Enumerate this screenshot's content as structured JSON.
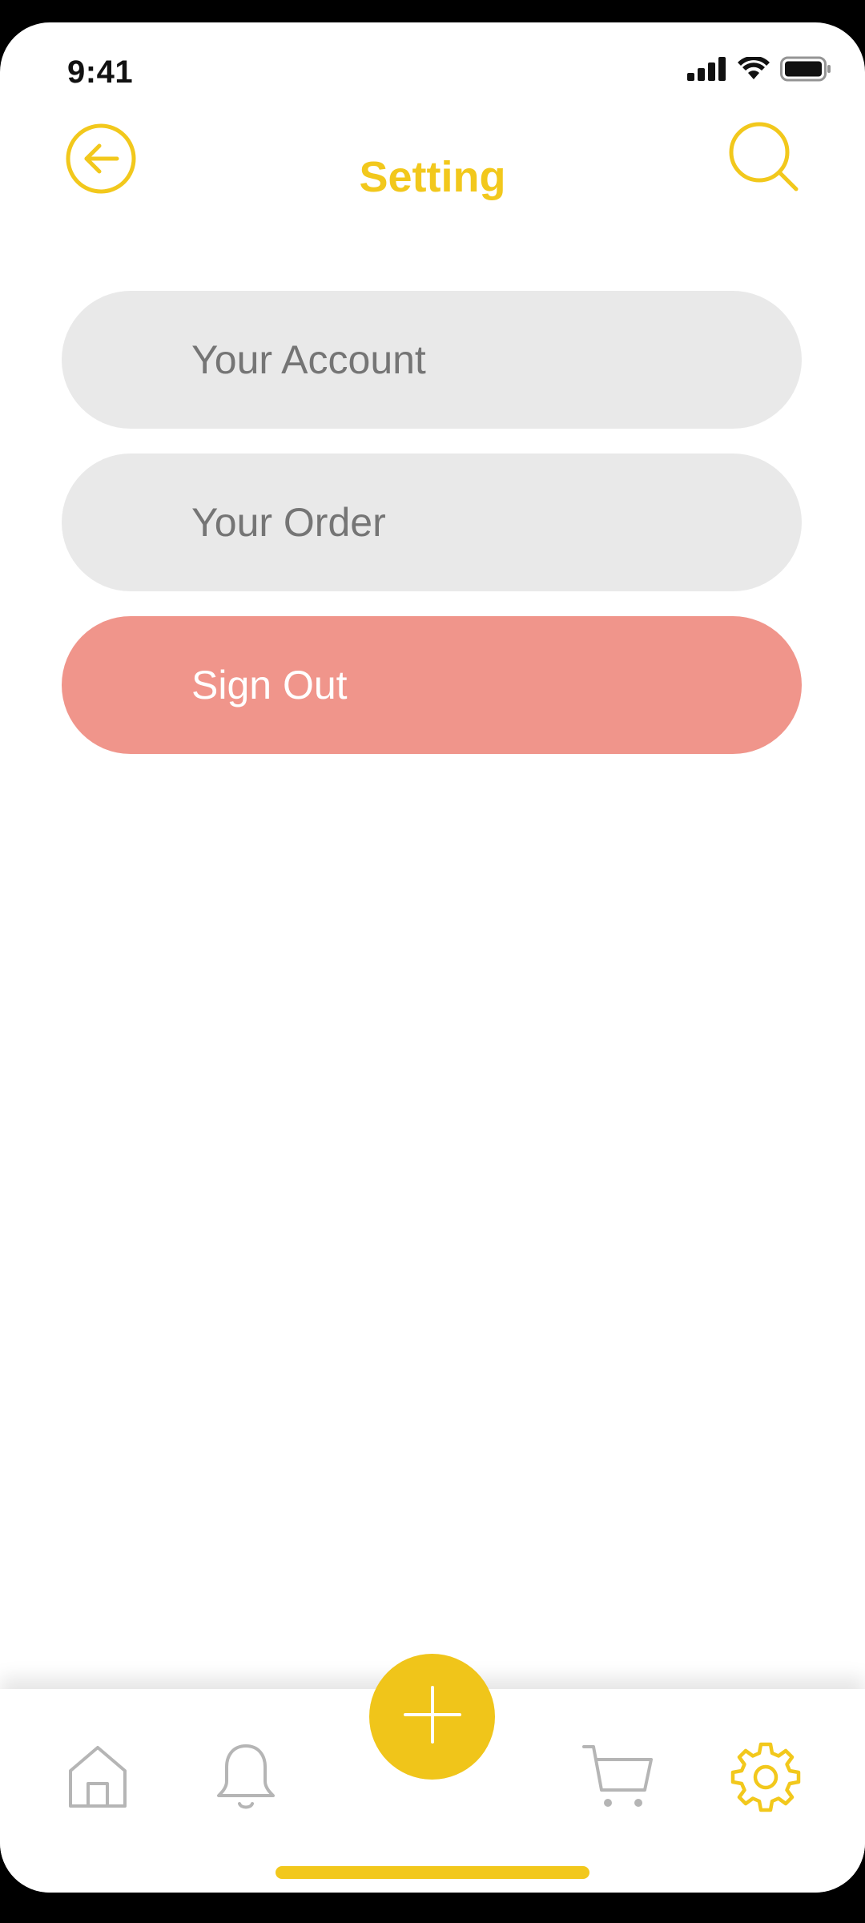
{
  "status_bar": {
    "time": "9:41",
    "icons": [
      "signal-icon",
      "wifi-icon",
      "battery-icon"
    ]
  },
  "header": {
    "title": "Setting",
    "back_icon": "arrow-left-circle-icon",
    "search_icon": "search-icon"
  },
  "menu": {
    "items": [
      {
        "label": "Your Account"
      },
      {
        "label": "Your Order"
      },
      {
        "label": "Sign Out"
      }
    ]
  },
  "bottom_nav": {
    "items": [
      "home-icon",
      "bell-icon",
      "plus-icon",
      "cart-icon",
      "gear-icon"
    ],
    "active": "gear-icon"
  },
  "colors": {
    "accent": "#f2c81c",
    "pill": "#e9e9e9",
    "danger": "#f0958b",
    "inactive": "#b5b5b5"
  }
}
